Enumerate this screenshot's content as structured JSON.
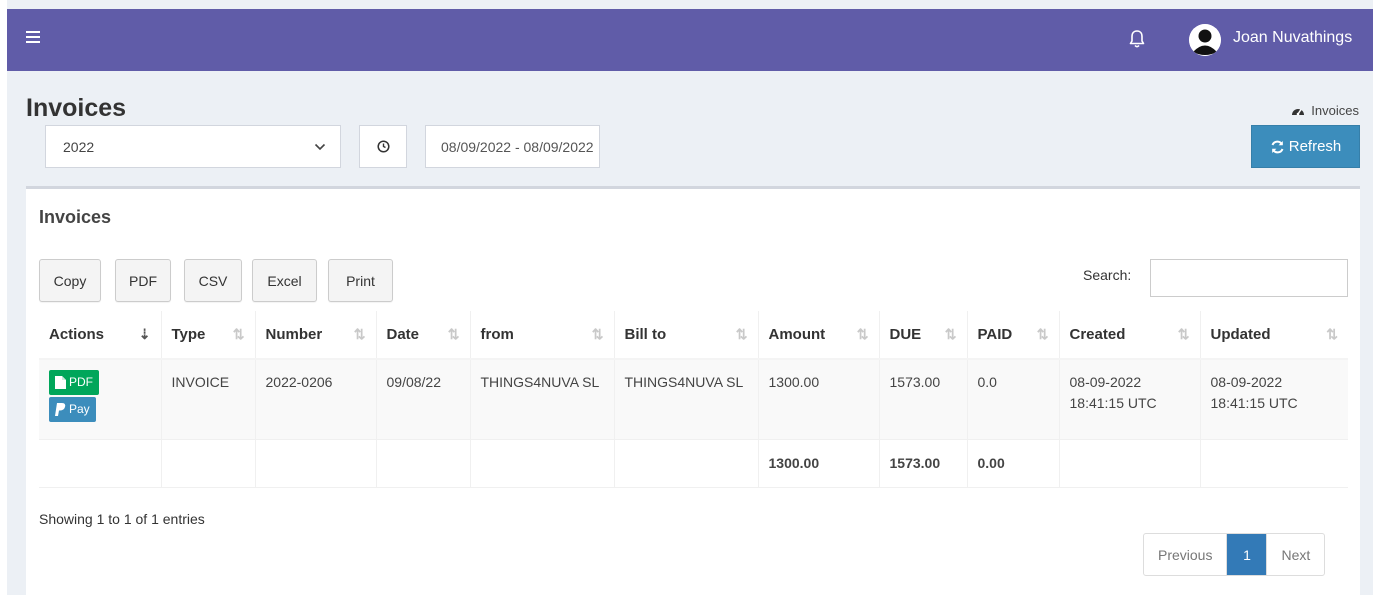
{
  "topbar": {
    "user_name": "Joan Nuvathings",
    "color": "#605ca8",
    "icons": [
      "menu-icon",
      "bell-icon",
      "user-avatar-icon"
    ]
  },
  "page": {
    "title": "Invoices",
    "breadcrumb": "Invoices"
  },
  "filters": {
    "year": "2022",
    "date_range": "08/09/2022 - 08/09/2022",
    "refresh_label": "Refresh"
  },
  "box": {
    "title": "Invoices",
    "buttons": [
      "Copy",
      "PDF",
      "CSV",
      "Excel",
      "Print"
    ],
    "search_label": "Search:"
  },
  "table": {
    "headers": [
      "Actions",
      "Type",
      "Number",
      "Date",
      "from",
      "Bill to",
      "Amount",
      "DUE",
      "PAID",
      "Created",
      "Updated"
    ],
    "rows": [
      {
        "pdf_label": "PDF",
        "pay_label": "Pay",
        "type": "INVOICE",
        "number": "2022-0206",
        "date": "09/08/22",
        "from": "THINGS4NUVA SL",
        "bill_to": "THINGS4NUVA SL",
        "amount": "1300.00",
        "due": "1573.00",
        "paid": "0.0",
        "created": "08-09-2022 18:41:15 UTC",
        "updated": "08-09-2022 18:41:15 UTC"
      }
    ],
    "totals": {
      "amount": "1300.00",
      "due": "1573.00",
      "paid": "0.00"
    }
  },
  "footer": {
    "info": "Showing 1 to 1 of 1 entries",
    "previous": "Previous",
    "page": "1",
    "next": "Next"
  }
}
